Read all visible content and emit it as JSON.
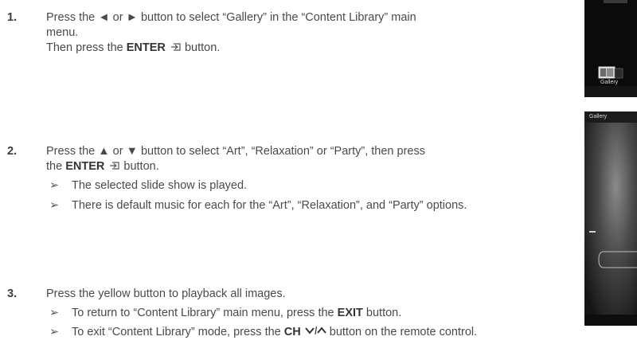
{
  "steps": [
    {
      "number": "1.",
      "line1": "Press the ◄ or ► button to select “Gallery” in the “Content Library” main",
      "line2": "menu.",
      "line3_pre": "Then press the ",
      "line3_bold": "ENTER",
      "line3_post": " button."
    },
    {
      "number": "2.",
      "line1": "Press the ▲ or ▼ button to select “Art”, “Relaxation” or “Party”, then press",
      "line2_pre": "the  ",
      "line2_bold": "ENTER",
      "line2_post": "  button.",
      "notes": [
        "The selected slide show is played.",
        "There is default music for each for the “Art”, “Relaxation”, and “Party” options."
      ]
    },
    {
      "number": "3.",
      "line1": "Press the yellow button to playback all images.",
      "note1_pre": "To return to “Content Library” main menu, press the ",
      "note1_bold": "EXIT",
      "note1_post": " button.",
      "note2_pre": "To exit “Content Library” mode, press the ",
      "note2_bold": "CH",
      "note2_post": " button on the remote control."
    }
  ],
  "note_arrow": "➢",
  "thumbnails": [
    {
      "label": "Gallery",
      "icon": "gallery-menu-icon"
    },
    {
      "label": "Gallery",
      "icon": "slideshow-background"
    }
  ],
  "colors": {
    "text": "#4a4a4a",
    "thumb_bg": "#0b0b0b"
  }
}
